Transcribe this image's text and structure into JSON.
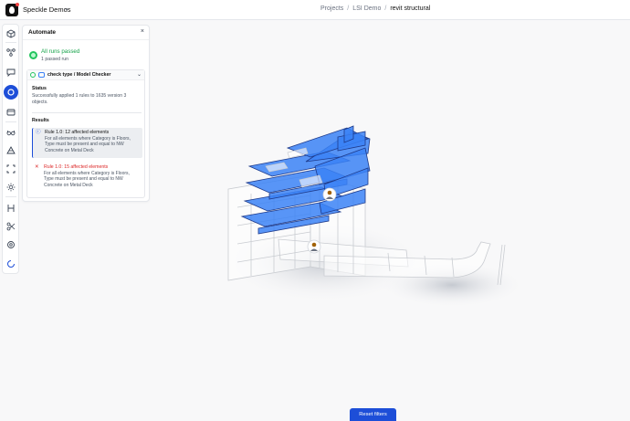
{
  "header": {
    "workspace": "Speckle Demos",
    "breadcrumb": [
      "Projects",
      "LSI Demo",
      "revit structural"
    ]
  },
  "toolbar": {
    "items": [
      {
        "icon": "cube-icon"
      },
      {
        "icon": "models-icon"
      },
      {
        "icon": "comments-icon"
      },
      {
        "icon": "automate-icon",
        "active": true
      },
      {
        "icon": "datasets-icon"
      },
      {
        "icon": "glasses-icon"
      },
      {
        "icon": "views-icon"
      },
      {
        "icon": "fullscreen-icon"
      },
      {
        "icon": "sun-icon"
      },
      {
        "icon": "measure-icon"
      },
      {
        "icon": "scissors-icon"
      },
      {
        "icon": "explode-icon"
      },
      {
        "icon": "spinner-icon"
      }
    ]
  },
  "panel": {
    "title": "Automate",
    "close": "×",
    "status_title": "All runs passed",
    "status_sub": "1 passed run",
    "card": {
      "title": "check type / Model Checker",
      "status_label": "Status",
      "status_text": "Successfully applied 1 rules to 1635 version 3 objects.",
      "results_label": "Results",
      "rules": [
        {
          "title": "Rule 1.0: 12 affected elements",
          "description": "For all elements where Category is Floors, Type must be present and equal to NW Concrete on Metal Deck",
          "level": "info"
        },
        {
          "title": "Rule 1.0: 15 affected elements",
          "description": "For all elements where Category is Floors, Type must be present and equal to NW Concrete on Metal Deck",
          "level": "error"
        }
      ]
    }
  },
  "footer": {
    "reset_label": "Reset filters"
  },
  "colors": {
    "accent": "#1d4ed8",
    "success": "#22c55e",
    "error": "#dc2626",
    "highlight": "#3b82f6"
  }
}
